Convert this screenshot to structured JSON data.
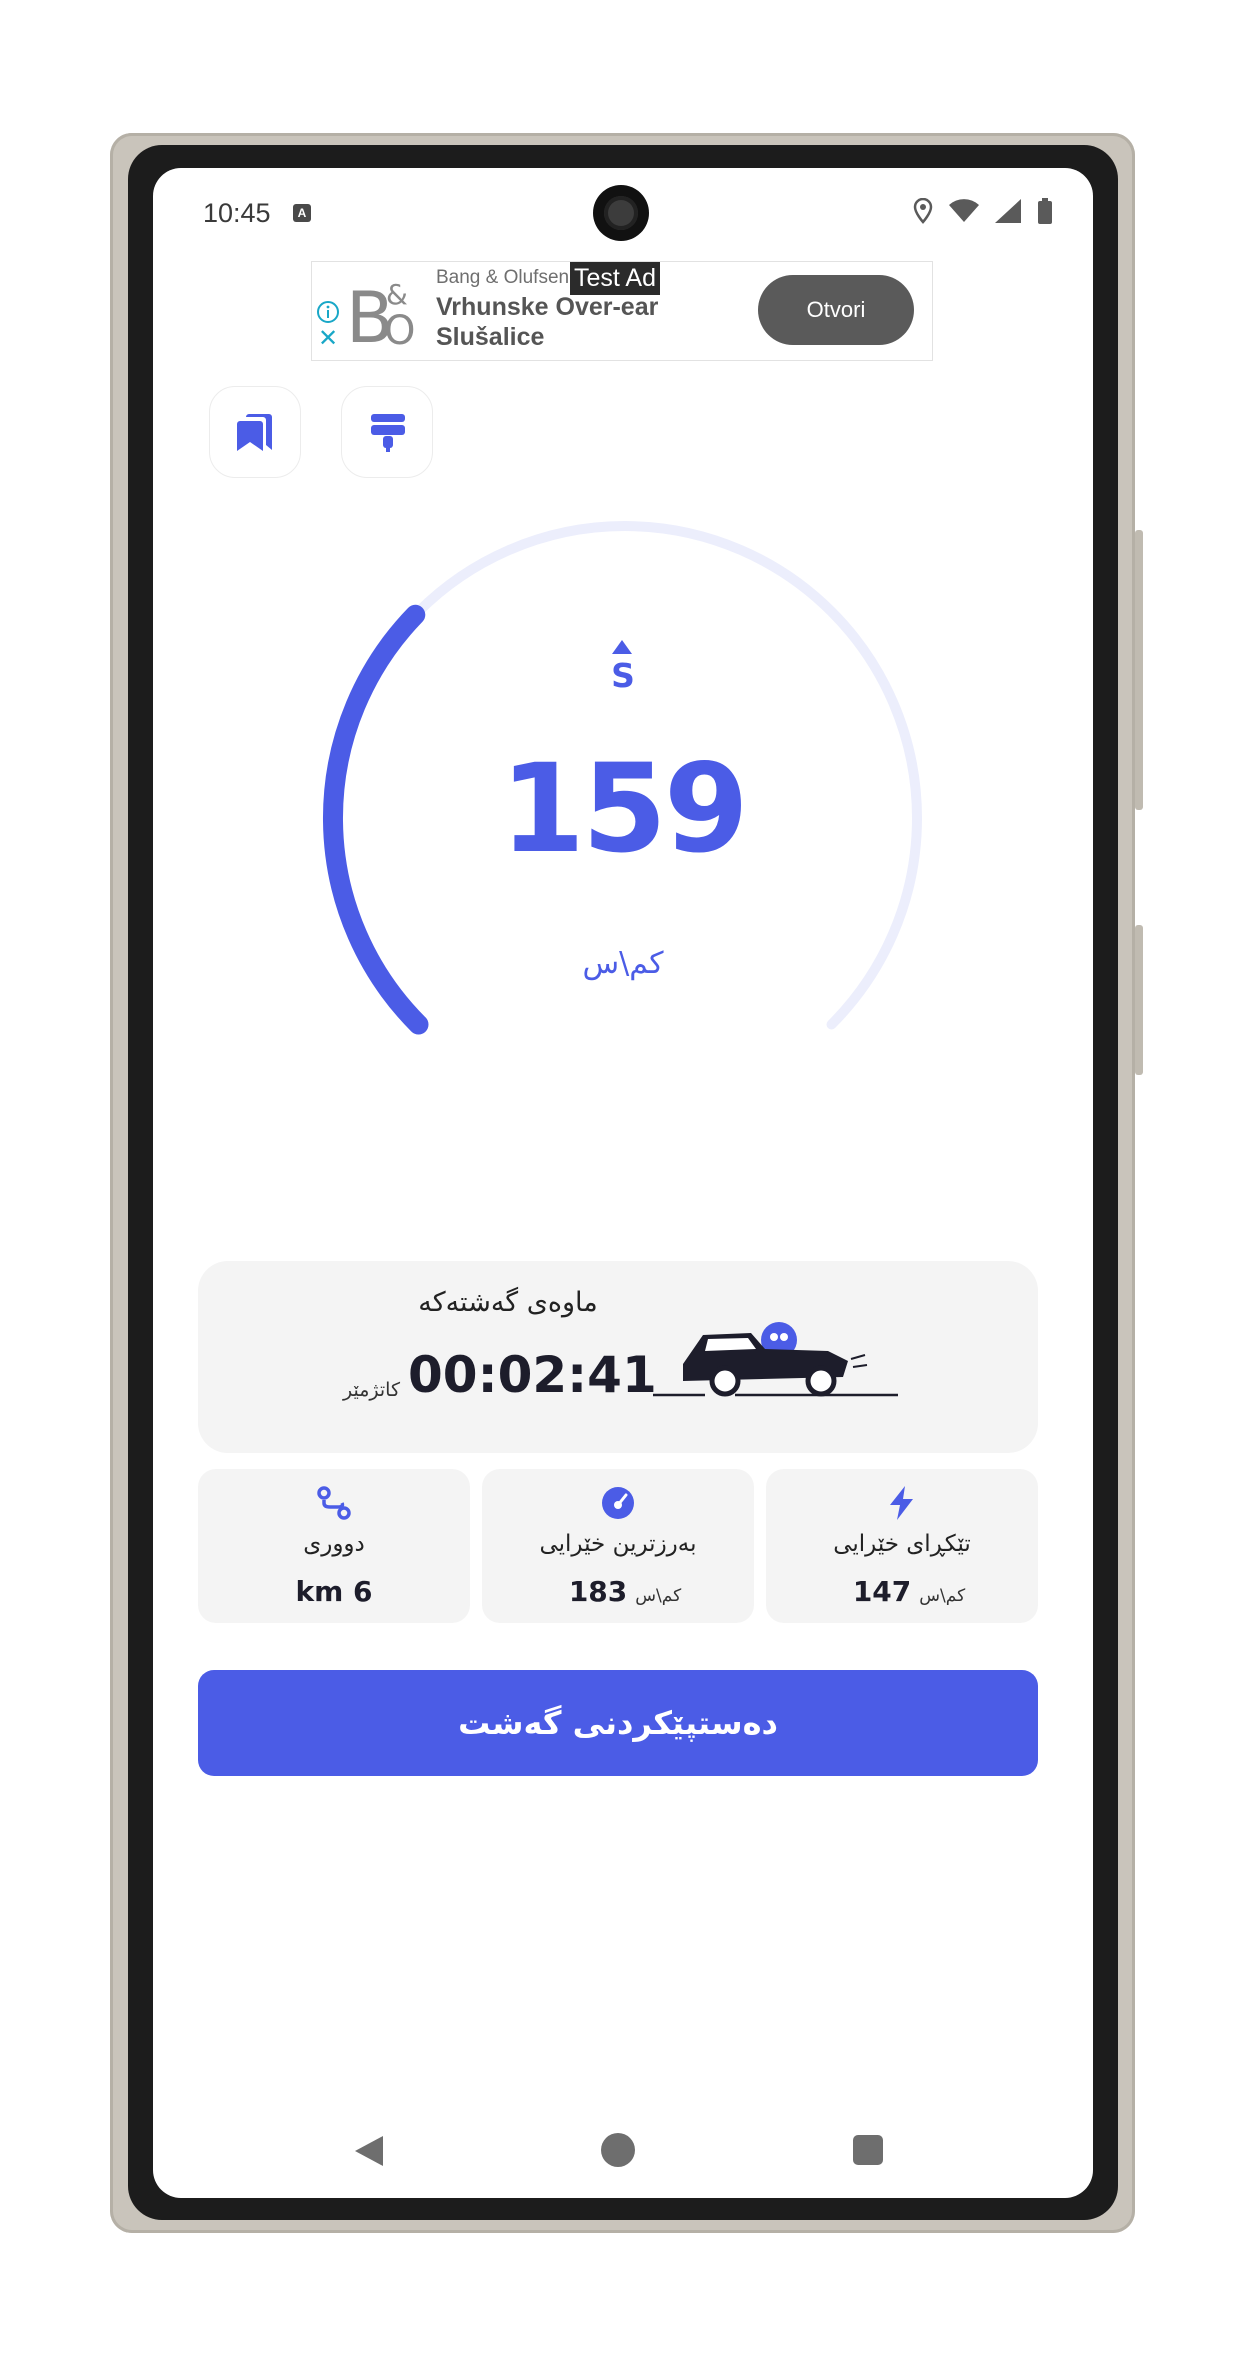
{
  "status_bar": {
    "time": "10:45",
    "notification_icon": "A"
  },
  "ad": {
    "tag": "Test Ad",
    "brand": "Bang & Olufsen",
    "title": "Vrhunske Over-ear Slušalice",
    "cta": "Otvori",
    "logo_text": "B&O"
  },
  "toolbar": {
    "bookmarks_icon": "bookmarks-icon",
    "theme_icon": "paint-roller-icon"
  },
  "speedometer": {
    "direction": "S",
    "speed": "159",
    "unit": "کم\\س",
    "gauge_fraction": 0.33,
    "accent": "#4b5ce6",
    "track": "#eceefc"
  },
  "trip_duration": {
    "label": "ماوەی گەشتەکە",
    "value": "00:02:41",
    "unit": "کاتژمێر"
  },
  "stats": [
    {
      "icon": "lightning-icon",
      "label": "تێکڕای خێرایی",
      "value": "147",
      "unit": "کم\\س"
    },
    {
      "icon": "speedometer-icon",
      "label": "بەرزترین خێرایی",
      "value": "183",
      "unit": "کم\\س"
    },
    {
      "icon": "route-icon",
      "label": "دووری",
      "value": "km 6",
      "unit": ""
    }
  ],
  "start_trip_button": "دەستپێکردنی گەشت"
}
